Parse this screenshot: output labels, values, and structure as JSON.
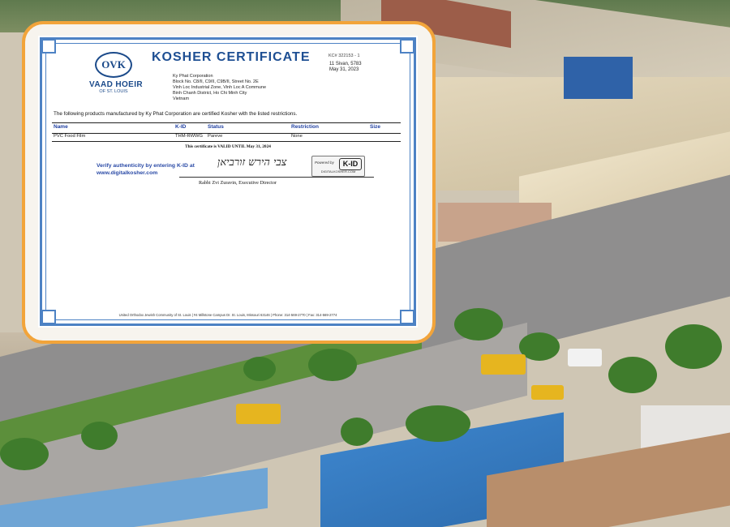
{
  "certificate": {
    "org_logo_mark": "OVK",
    "org_name": "VAAD HOEIR",
    "org_sub": "OF ST. LOUIS",
    "title": "KOSHER CERTIFICATE",
    "kc_number": "KC# 322153 - 1",
    "date_hebrew": "11 Sivan, 5783",
    "date_english": "May 31, 2023",
    "address_lines": [
      "Ky Phat Corporation",
      "Block No. C8/II, C9/II, C9B/II, Street No. 2E",
      "Vinh Loc Industrial Zone, Vinh Loc A Commune",
      "Binh Chanh District, Ho Chi Minh City",
      "Vietnam"
    ],
    "intro": "The following products manufactured by Ky Phat Corporation are certified Kosher with the listed restrictions.",
    "table": {
      "headers": [
        "Name",
        "K-ID",
        "Status",
        "Restriction",
        "Size"
      ],
      "rows": [
        [
          "PVC Food Film",
          "THM-RWWG",
          "Pareve",
          "None",
          ""
        ]
      ]
    },
    "valid_until": "This certificate is VALID UNTIL May 31, 2024",
    "verify_line1": "Verify authenticity by entering K-ID at",
    "verify_line2": "www.digitalkosher.com",
    "signature": "צבי הירש זורביאן",
    "signer": "Rabbi Zvi Zuravin, Executive Director",
    "badge_powered": "Powered by",
    "badge_logo": "K-ID",
    "badge_url": "DIGITALKOSHER.COM",
    "footer": "United Orthodox Jewish Community of St. Louis | #4 Millstone Campus Dr. St. Louis, Missouri 63146 | Phone: 314-569-2770 | Fax: 314-569-2774"
  },
  "colors": {
    "frame_accent": "#f2a43a",
    "border_blue": "#4d82c4",
    "title_blue": "#1e4f93",
    "link_blue": "#2a4aa6"
  }
}
